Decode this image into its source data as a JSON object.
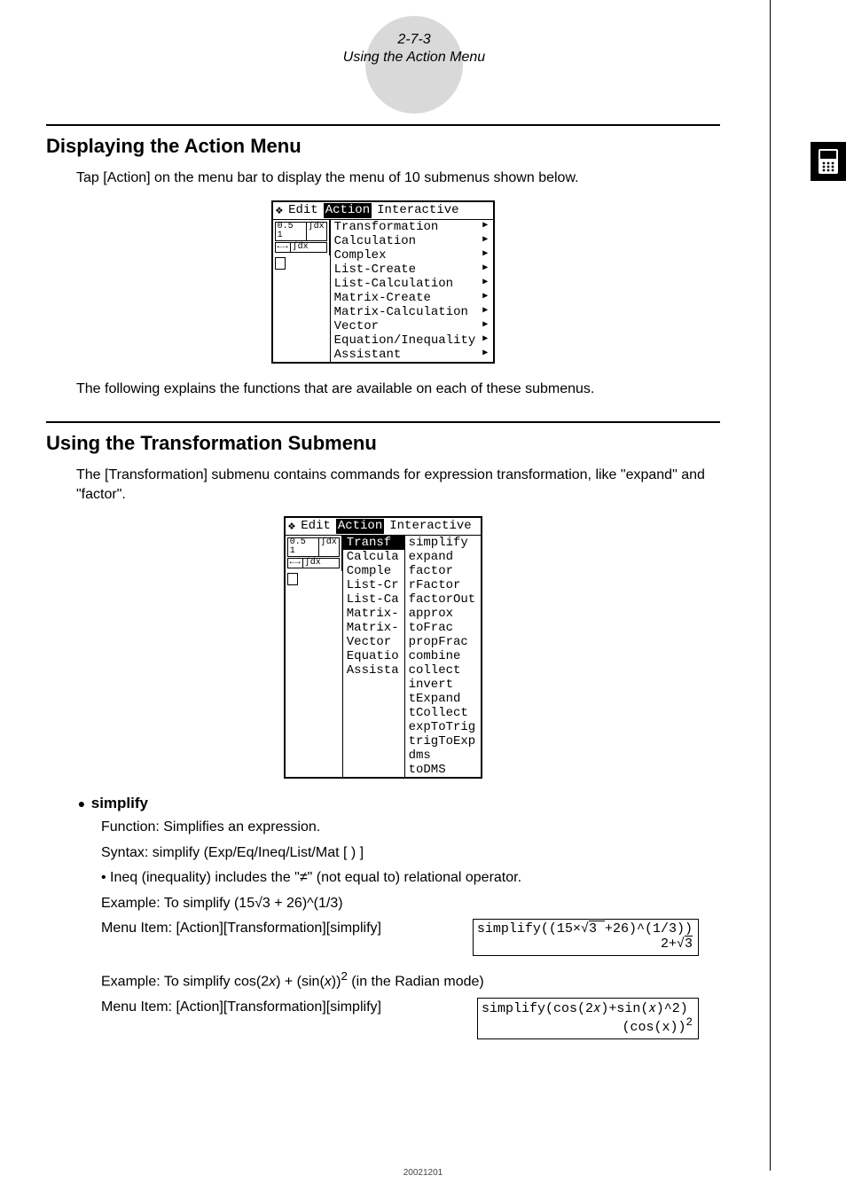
{
  "header": {
    "page_num": "2-7-3",
    "subtitle": "Using the Action Menu"
  },
  "section1": {
    "title": "Displaying the Action Menu",
    "intro": "Tap [Action] on the menu bar to display the menu of 10 submenus shown below.",
    "outro": "The following explains the functions that are available on each of these submenus."
  },
  "menubar": {
    "dropdown_glyph": "❖",
    "edit": "Edit",
    "action": "Action",
    "interactive": "Interactive"
  },
  "toolbar": {
    "c1": "0.5 1",
    "c2": "∫dx",
    "c3": "←→",
    "c4": "∫dx"
  },
  "action_menu": [
    "Transformation",
    "Calculation",
    "Complex",
    "List-Create",
    "List-Calculation",
    "Matrix-Create",
    "Matrix-Calculation",
    "Vector",
    "Equation/Inequality",
    "Assistant"
  ],
  "section2": {
    "title": "Using the Transformation Submenu",
    "intro": "The [Transformation] submenu contains commands for expression transformation, like \"expand\" and \"factor\"."
  },
  "action_menu_trunc": [
    "Transf",
    "Calcula",
    "Comple",
    "List-Cr",
    "List-Ca",
    "Matrix-",
    "Matrix-",
    "Vector",
    "Equatio",
    "Assista"
  ],
  "transform_submenu": [
    "simplify",
    "expand",
    "factor",
    "rFactor",
    "factorOut",
    "approx",
    "toFrac",
    "propFrac",
    "combine",
    "collect",
    "invert",
    "tExpand",
    "tCollect",
    "expToTrig",
    "trigToExp",
    "dms",
    "toDMS"
  ],
  "simplify": {
    "heading": "simplify",
    "func_label": "Function: Simplifies an expression.",
    "syntax": "Syntax: simplify (Exp/Eq/Ineq/List/Mat [ ) ]",
    "ineq_note_prefix": "• Ineq (inequality) includes the \"",
    "ineq_symbol": "≠",
    "ineq_note_suffix": "\" (not equal to) relational operator.",
    "ex1_prefix": "Example: To simplify (15",
    "ex1_sqrt": "√3",
    "ex1_suffix": " + 26)^(1/3)",
    "ex1_menu": "Menu Item: [Action][Transformation][simplify]",
    "ex1_in_prefix": "simplify((15×√",
    "ex1_in_rad": "3 ",
    "ex1_in_suffix": "+26)^(1/3))",
    "ex1_out_prefix": "2+√",
    "ex1_out_rad": "3 ",
    "ex2_prefix": "Example: To simplify cos(2",
    "ex2_var1": "x",
    "ex2_mid": ") + (sin(",
    "ex2_var2": "x",
    "ex2_suffix_a": "))",
    "ex2_sup": "2",
    "ex2_suffix_b": " (in the Radian mode)",
    "ex2_menu": "Menu Item: [Action][Transformation][simplify]",
    "ex2_in": "simplify(cos(2𝑥)+sin(𝑥)^2)",
    "ex2_out_base": "(cos(x))",
    "ex2_out_sup": "2"
  },
  "footer_code": "20021201"
}
